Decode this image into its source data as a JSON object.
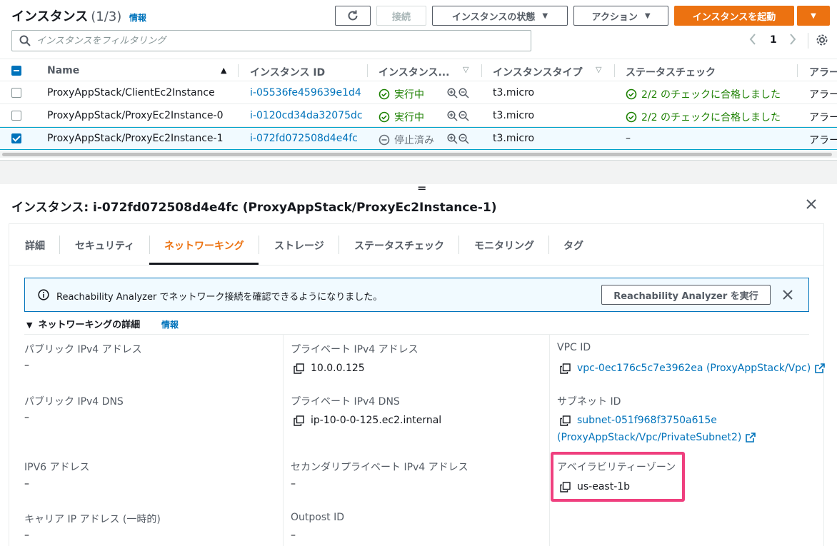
{
  "header": {
    "title": "インスタンス",
    "count": "(1/3)",
    "info": "情報"
  },
  "toolbar": {
    "refresh_icon": "refresh-icon",
    "connect_label": "接続",
    "instance_state_label": "インスタンスの状態",
    "actions_label": "アクション",
    "launch_label": "インスタンスを起動"
  },
  "search": {
    "placeholder": "インスタンスをフィルタリング"
  },
  "pagination": {
    "current_page": "1"
  },
  "table": {
    "columns": [
      "Name",
      "インスタンス ID",
      "インスタンス...",
      "インスタンスタイプ",
      "ステータスチェック",
      "アラー"
    ],
    "rows": [
      {
        "name": "ProxyAppStack/ClientEc2Instance",
        "instance_id": "i-05536fe459639e1d4",
        "state": "実行中",
        "type": "t3.micro",
        "status_check": "2/2 のチェックに合格しました",
        "alarm": "アラー",
        "selected": false
      },
      {
        "name": "ProxyAppStack/ProxyEc2Instance-0",
        "instance_id": "i-0120cd34da32075dc",
        "state": "実行中",
        "type": "t3.micro",
        "status_check": "2/2 のチェックに合格しました",
        "alarm": "アラー",
        "selected": false
      },
      {
        "name": "ProxyAppStack/ProxyEc2Instance-1",
        "instance_id": "i-072fd072508d4e4fc",
        "state": "停止済み",
        "type": "t3.micro",
        "status_check": "–",
        "alarm": "アラー",
        "selected": true
      }
    ]
  },
  "detail": {
    "title": "インスタンス: i-072fd072508d4e4fc (ProxyAppStack/ProxyEc2Instance-1)",
    "tabs": [
      "詳細",
      "セキュリティ",
      "ネットワーキング",
      "ストレージ",
      "ステータスチェック",
      "モニタリング",
      "タグ"
    ],
    "active_tab": "ネットワーキング",
    "banner": {
      "text": "Reachability Analyzer でネットワーク接続を確認できるようになりました。",
      "button": "Reachability Analyzer を実行"
    },
    "section": {
      "title": "ネットワーキングの詳細",
      "info": "情報"
    },
    "fields": {
      "public_ipv4_label": "パブリック IPv4 アドレス",
      "public_ipv4_value": "–",
      "private_ipv4_label": "プライベート IPv4 アドレス",
      "private_ipv4_value": "10.0.0.125",
      "vpc_id_label": "VPC ID",
      "vpc_id_value": "vpc-0ec176c5c7e3962ea (ProxyAppStack/Vpc)",
      "public_dns_label": "パブリック IPv4 DNS",
      "public_dns_value": "–",
      "private_dns_label": "プライベート IPv4 DNS",
      "private_dns_value": "ip-10-0-0-125.ec2.internal",
      "subnet_id_label": "サブネット ID",
      "subnet_id_value_1": "subnet-051f968f3750a615e",
      "subnet_id_value_2": "(ProxyAppStack/Vpc/PrivateSubnet2)",
      "ipv6_label": "IPV6 アドレス",
      "ipv6_value": "–",
      "secondary_ipv4_label": "セカンダリプライベート IPv4 アドレス",
      "secondary_ipv4_value": "–",
      "az_label": "アベイラビリティーゾーン",
      "az_value": "us-east-1b",
      "carrier_ip_label": "キャリア IP アドレス (一時的)",
      "carrier_ip_value": "–",
      "outpost_label": "Outpost ID",
      "outpost_value": "–"
    }
  },
  "colors": {
    "accent_orange": "#ec7211",
    "link_blue": "#0073bb",
    "success_green": "#1d8102",
    "highlight_pink": "#ef3f7e"
  }
}
